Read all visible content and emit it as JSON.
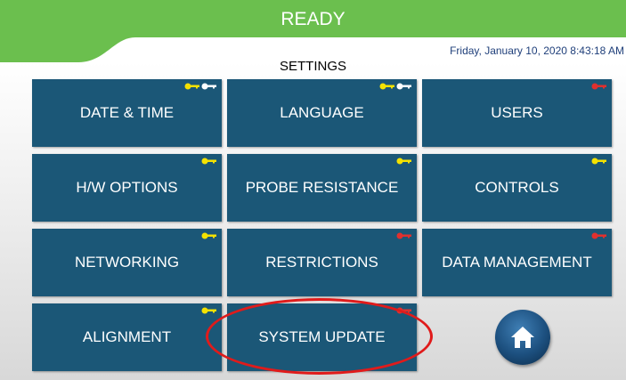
{
  "status": {
    "text": "READY",
    "color": "#6bbf4e"
  },
  "datetime": "Friday, January 10, 2020 8:43:18 AM",
  "heading": "SETTINGS",
  "colors": {
    "tile": "#1b5777",
    "key_yellow": "#f4e200",
    "key_white": "#ffffff",
    "key_red": "#e0302e",
    "highlight": "#e01b1b"
  },
  "tiles": [
    {
      "label": "DATE & TIME",
      "keys": [
        "yellow",
        "white"
      ]
    },
    {
      "label": "LANGUAGE",
      "keys": [
        "yellow",
        "white"
      ]
    },
    {
      "label": "USERS",
      "keys": [
        "red"
      ]
    },
    {
      "label": "H/W OPTIONS",
      "keys": [
        "yellow"
      ]
    },
    {
      "label": "PROBE RESISTANCE",
      "keys": [
        "yellow"
      ]
    },
    {
      "label": "CONTROLS",
      "keys": [
        "yellow"
      ]
    },
    {
      "label": "NETWORKING",
      "keys": [
        "yellow"
      ]
    },
    {
      "label": "RESTRICTIONS",
      "keys": [
        "red"
      ]
    },
    {
      "label": "DATA MANAGEMENT",
      "keys": [
        "red"
      ]
    },
    {
      "label": "ALIGNMENT",
      "keys": [
        "yellow"
      ]
    },
    {
      "label": "SYSTEM UPDATE",
      "keys": [
        "red"
      ]
    }
  ],
  "home": {
    "icon": "home-icon"
  }
}
